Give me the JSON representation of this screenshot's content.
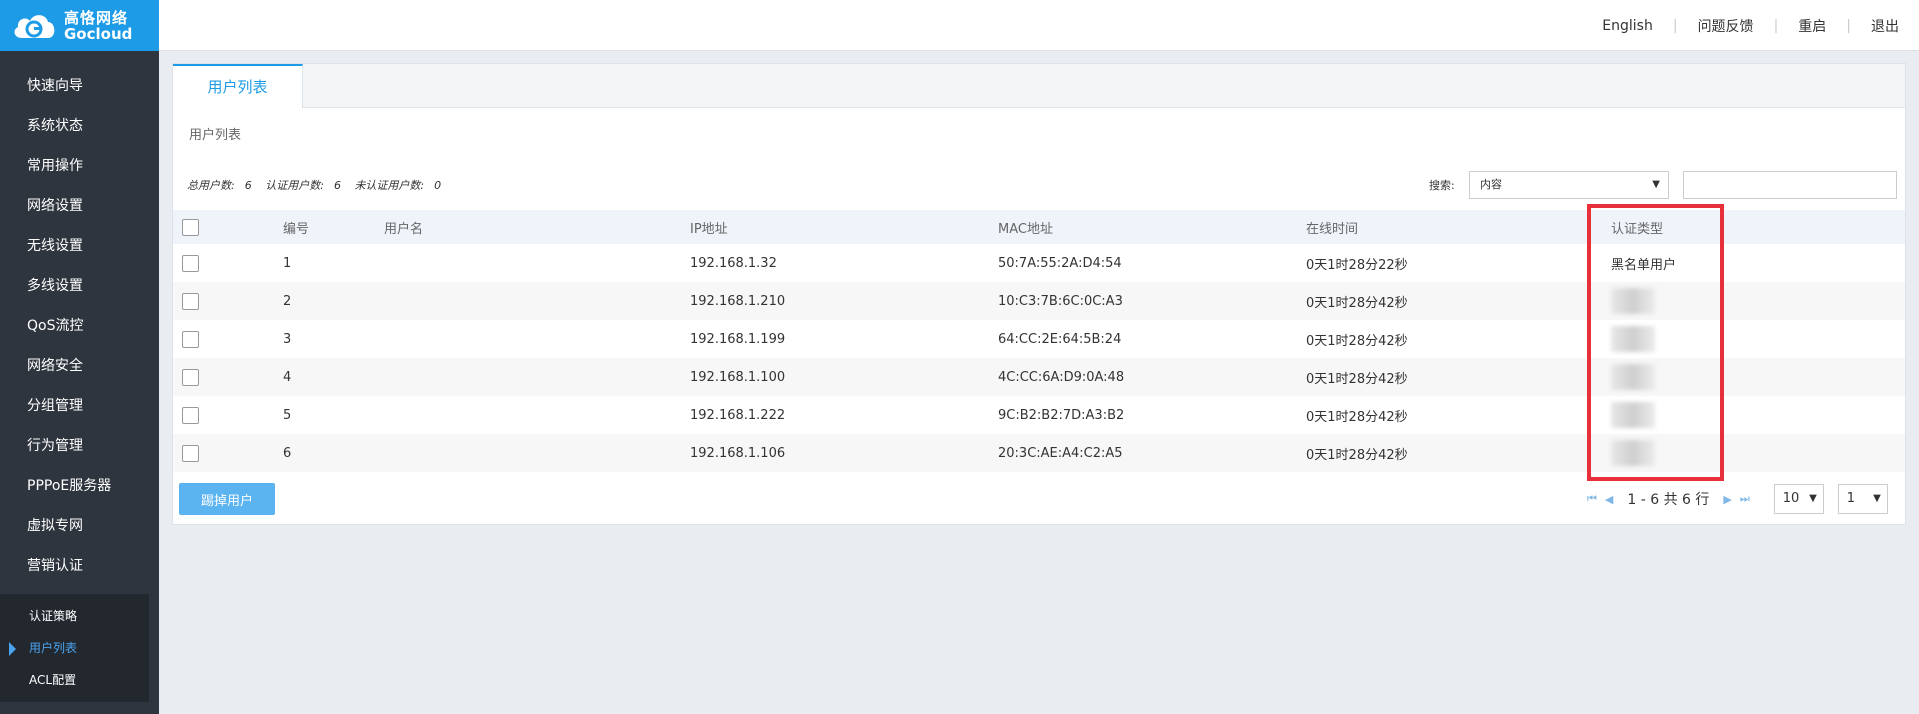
{
  "brand": {
    "name_cn": "高恪网络",
    "name_en": "Gocloud"
  },
  "sidebar": {
    "items": [
      {
        "label": "快速向导"
      },
      {
        "label": "系统状态"
      },
      {
        "label": "常用操作"
      },
      {
        "label": "网络设置"
      },
      {
        "label": "无线设置"
      },
      {
        "label": "多线设置"
      },
      {
        "label": "QoS流控"
      },
      {
        "label": "网络安全"
      },
      {
        "label": "分组管理"
      },
      {
        "label": "行为管理"
      },
      {
        "label": "PPPoE服务器"
      },
      {
        "label": "虚拟专网"
      },
      {
        "label": "营销认证"
      }
    ],
    "subitems": [
      {
        "label": "认证策略"
      },
      {
        "label": "用户列表"
      },
      {
        "label": "ACL配置"
      }
    ]
  },
  "header": {
    "english": "English",
    "feedback": "问题反馈",
    "restart": "重启",
    "logout": "退出"
  },
  "tab": {
    "label": "用户列表"
  },
  "section_title": "用户列表",
  "counts": {
    "total_label": "总用户数:",
    "total": "6",
    "auth_label": "认证用户数:",
    "auth": "6",
    "unauth_label": "未认证用户数:",
    "unauth": "0"
  },
  "search": {
    "label": "搜索:",
    "selected": "内容",
    "value": ""
  },
  "table": {
    "headers": {
      "no": "编号",
      "user": "用户名",
      "ip": "IP地址",
      "mac": "MAC地址",
      "time": "在线时间",
      "type": "认证类型"
    },
    "rows": [
      {
        "no": "1",
        "user": "",
        "ip": "192.168.1.32",
        "mac": "50:7A:55:2A:D4:54",
        "time": "0天1时28分22秒",
        "type": "黑名单用户"
      },
      {
        "no": "2",
        "user": "",
        "ip": "192.168.1.210",
        "mac": "10:C3:7B:6C:0C:A3",
        "time": "0天1时28分42秒",
        "type": ""
      },
      {
        "no": "3",
        "user": "",
        "ip": "192.168.1.199",
        "mac": "64:CC:2E:64:5B:24",
        "time": "0天1时28分42秒",
        "type": ""
      },
      {
        "no": "4",
        "user": "",
        "ip": "192.168.1.100",
        "mac": "4C:CC:6A:D9:0A:48",
        "time": "0天1时28分42秒",
        "type": ""
      },
      {
        "no": "5",
        "user": "",
        "ip": "192.168.1.222",
        "mac": "9C:B2:B2:7D:A3:B2",
        "time": "0天1时28分42秒",
        "type": ""
      },
      {
        "no": "6",
        "user": "",
        "ip": "192.168.1.106",
        "mac": "20:3C:AE:A4:C2:A5",
        "time": "0天1时28分42秒",
        "type": ""
      }
    ]
  },
  "actions": {
    "kick": "踢掉用户"
  },
  "pager": {
    "summary": "1 - 6 共 6 行",
    "page_size": "10",
    "page": "1"
  },
  "colors": {
    "accent": "#1e9be7",
    "sidebar_bg": "#2f353e",
    "highlight": "#e8303a"
  }
}
